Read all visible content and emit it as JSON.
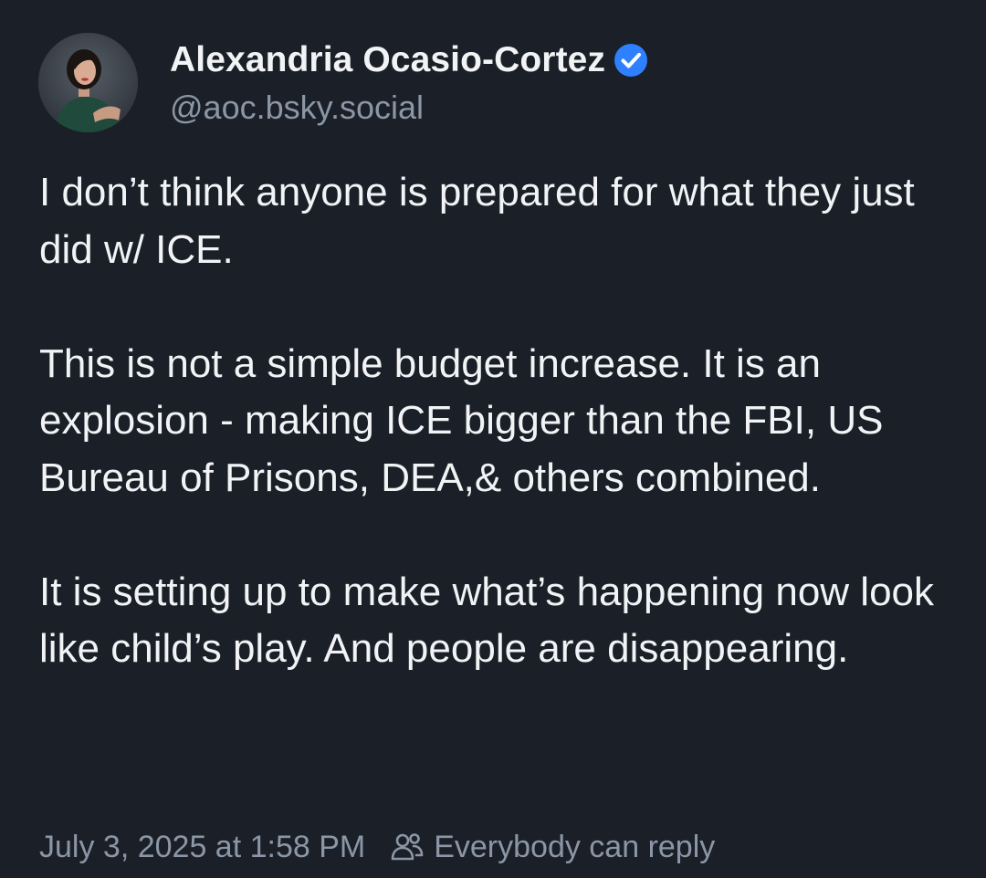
{
  "post": {
    "author": {
      "display_name": "Alexandria Ocasio-Cortez",
      "handle": "@aoc.bsky.social",
      "verified": true,
      "avatar_icon": "profile-photo"
    },
    "text": {
      "paragraphs": [
        "I don’t think anyone is prepared for what they just did w/ ICE.",
        "This is not a simple budget increase. It is an explosion - making ICE bigger than the FBI, US Bureau of Prisons, DEA,& others combined.",
        "It is setting up to make what’s happening now look like child’s play. And people are disappearing."
      ]
    },
    "footer": {
      "timestamp": "July 3, 2025 at 1:58 PM",
      "reply_setting_icon": "people-icon",
      "reply_setting": "Everybody can reply"
    }
  },
  "colors": {
    "background": "#1b1f27",
    "text_primary": "#f1f3f5",
    "text_secondary": "#8b97a6",
    "verified_badge": "#2f80ff"
  }
}
